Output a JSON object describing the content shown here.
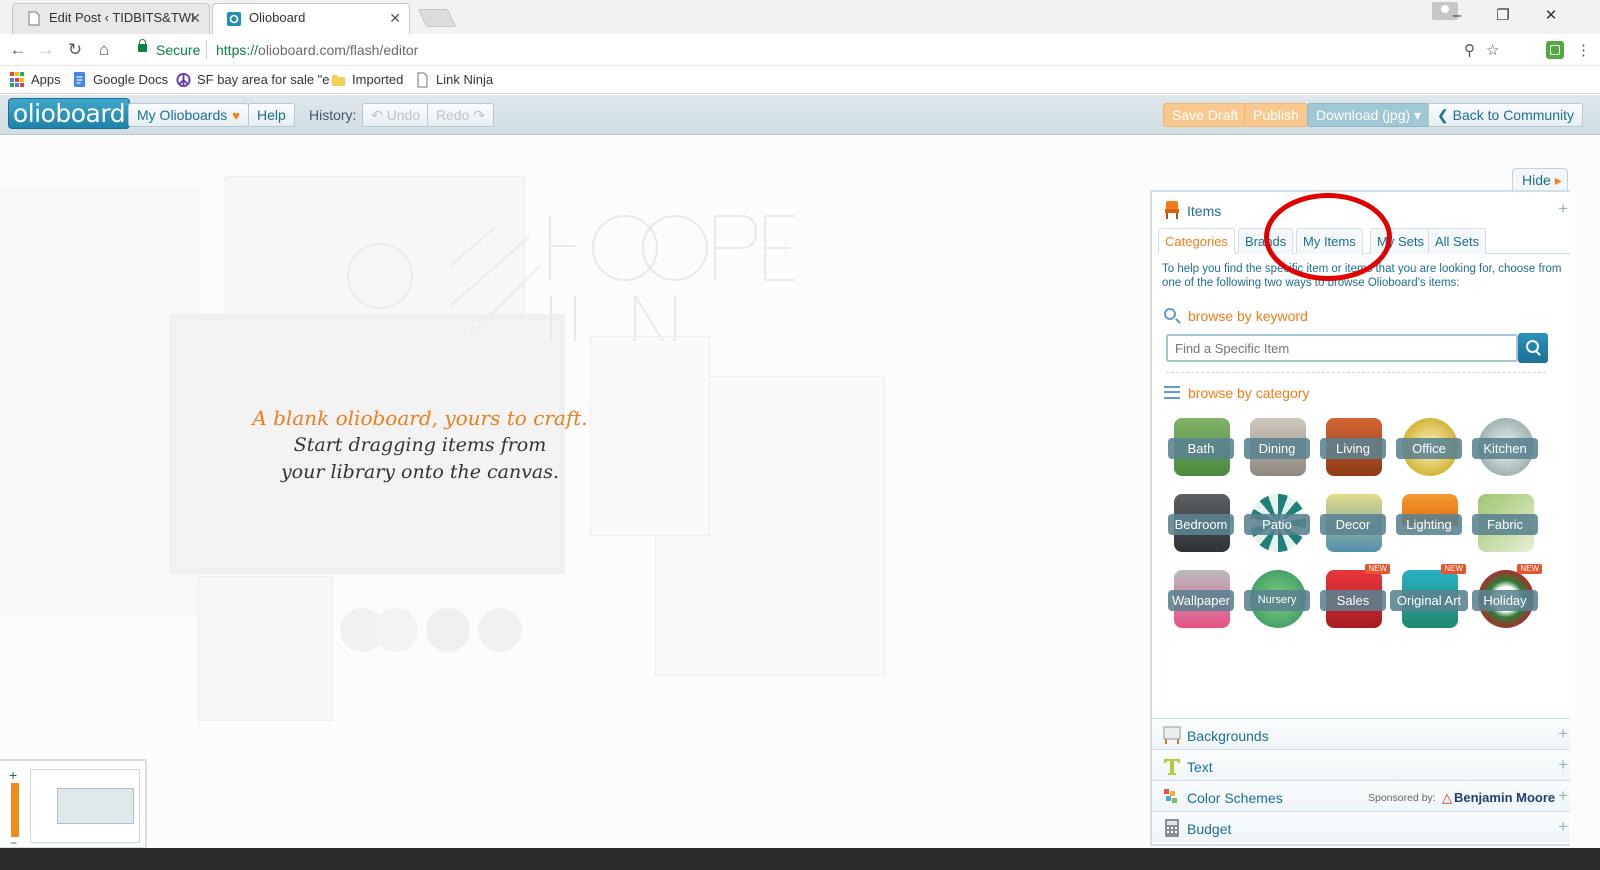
{
  "browser": {
    "tabs": [
      {
        "title": "Edit Post ‹ TIDBITS&TWI",
        "active": false
      },
      {
        "title": "Olioboard",
        "active": true
      }
    ],
    "security_label": "Secure",
    "url_scheme": "https://",
    "url_host": "olioboard.com",
    "url_path": "/flash/editor",
    "bookmarks": [
      {
        "label": "Apps",
        "icon": "apps-grid-icon"
      },
      {
        "label": "Google Docs",
        "icon": "google-docs-icon"
      },
      {
        "label": "SF bay area for sale \"e",
        "icon": "peace-sign-icon"
      },
      {
        "label": "Imported",
        "icon": "folder-icon"
      },
      {
        "label": "Link Ninja",
        "icon": "page-icon"
      }
    ]
  },
  "toolbar": {
    "logo": "olioboard",
    "my_olioboards": "My Olioboards",
    "help": "Help",
    "history_label": "History:",
    "undo": "↶ Undo",
    "redo": "Redo ↷",
    "save_draft": "Save Draft",
    "publish": "Publish",
    "download": "Download (jpg) ▾",
    "back": "❮ Back to Community"
  },
  "canvas": {
    "line1": "A blank olioboard, yours to craft.",
    "line2": "Start dragging items from",
    "line3": "your library onto the canvas."
  },
  "panel": {
    "hide": "Hide",
    "items_title": "Items",
    "tabs": [
      "Categories",
      "Brands",
      "My Items",
      "My Sets",
      "All Sets"
    ],
    "selected_tab": "Categories",
    "help_text": "To help you find the specific item or items that you are looking for, choose from one of the following two ways to browse Olioboard's items:",
    "browse_keyword": "browse by keyword",
    "search_placeholder": "Find a Specific Item",
    "browse_category": "browse by category",
    "categories": [
      {
        "label": "Bath"
      },
      {
        "label": "Dining"
      },
      {
        "label": "Living"
      },
      {
        "label": "Office"
      },
      {
        "label": "Kitchen"
      },
      {
        "label": "Bedroom"
      },
      {
        "label": "Patio"
      },
      {
        "label": "Decor"
      },
      {
        "label": "Lighting"
      },
      {
        "label": "Fabric"
      },
      {
        "label": "Wallpaper"
      },
      {
        "label": "Nursery"
      },
      {
        "label": "Sales",
        "badge": "NEW"
      },
      {
        "label": "Original Art",
        "badge": "NEW"
      },
      {
        "label": "Holiday",
        "badge": "NEW"
      }
    ],
    "sections": {
      "backgrounds": "Backgrounds",
      "text": "Text",
      "color_schemes": "Color Schemes",
      "sponsored_by": "Sponsored by:",
      "sponsor_brand": "Benjamin Moore",
      "budget": "Budget"
    }
  },
  "colors": {
    "accent_orange": "#f07d1a",
    "link_blue": "#1e6e91",
    "annotation_red": "#e00000"
  }
}
